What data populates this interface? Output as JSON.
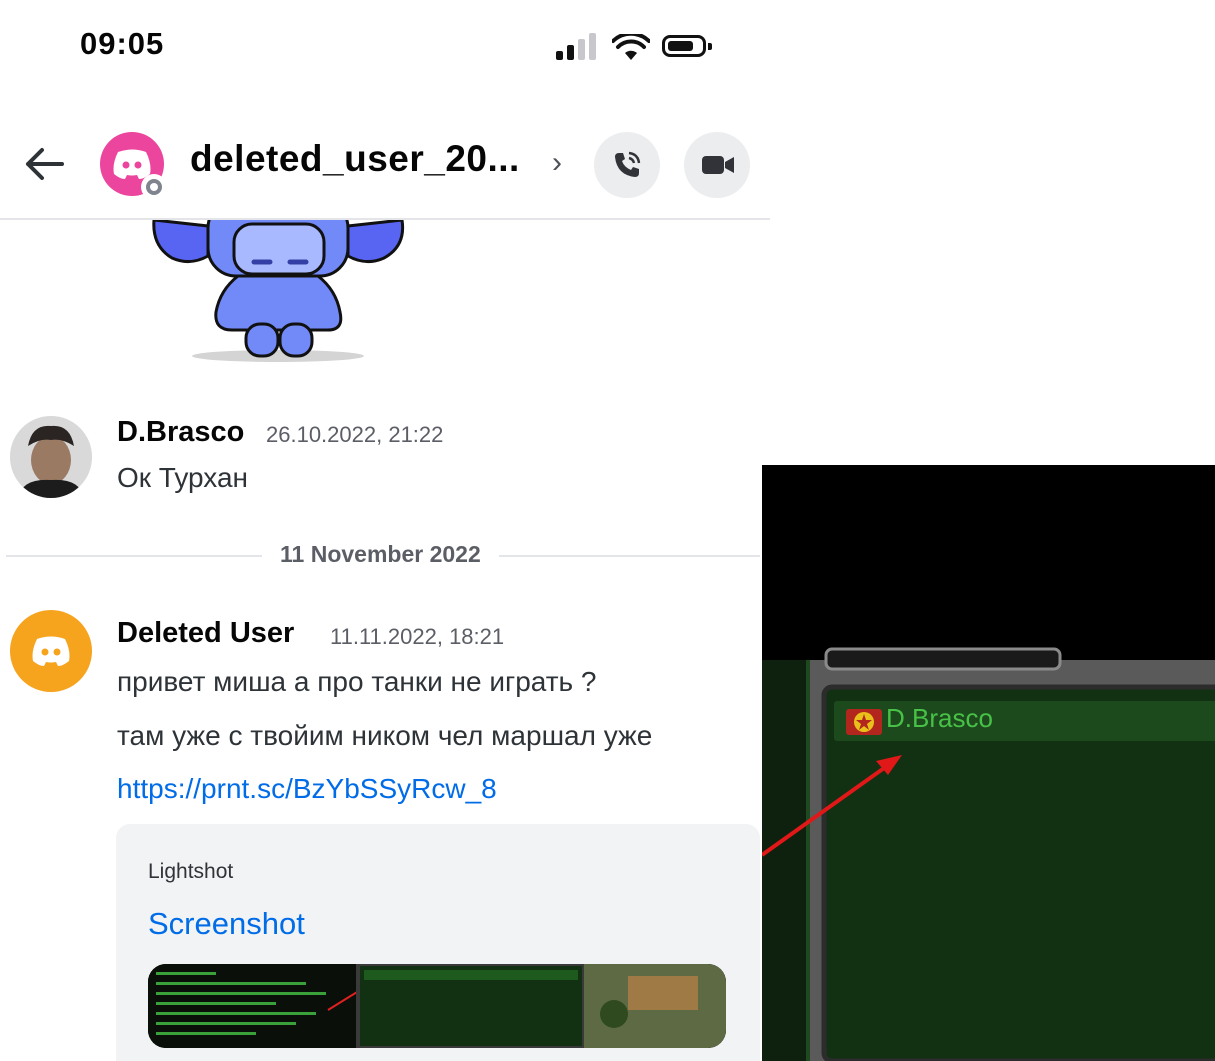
{
  "status_bar": {
    "time": "09:05"
  },
  "header": {
    "title": "deleted_user_20...",
    "chevron": "›",
    "avatar_color": "#eb459e"
  },
  "messages": [
    {
      "author": "D.Brasco",
      "timestamp": "26.10.2022, 21:22",
      "lines": [
        "Ок Турхан"
      ]
    },
    {
      "author": "Deleted User",
      "timestamp": "11.11.2022, 18:21",
      "avatar_color": "#f6a31d",
      "lines": [
        "привет миша а про танки не играть ?",
        "там уже с твойим ником чел маршал уже"
      ],
      "link": "https://prnt.sc/BzYbSSyRcw_8",
      "embed": {
        "provider": "Lightshot",
        "title": "Screenshot"
      }
    }
  ],
  "date_divider": "11 November 2022",
  "game_screenshot": {
    "player_name": "D.Brasco"
  },
  "colors": {
    "link": "#006ce7",
    "divider": "#e3e5e8",
    "game_green": "#0f2a0f"
  }
}
